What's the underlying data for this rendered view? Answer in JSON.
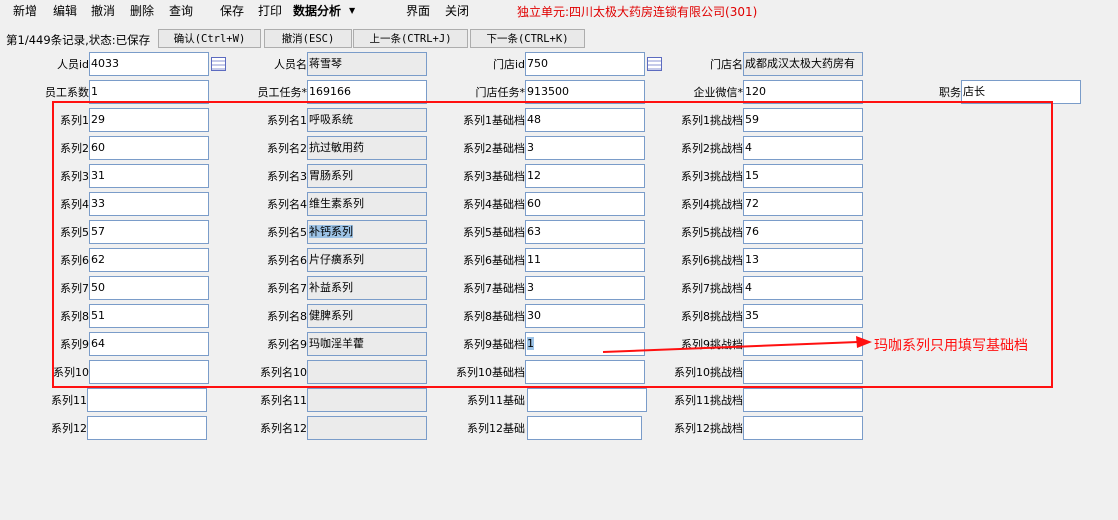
{
  "menu": {
    "items": [
      "新增",
      "编辑",
      "撤消",
      "删除",
      "查询",
      "保存",
      "打印",
      "数据分析",
      "界面",
      "关闭"
    ],
    "unit_title": "独立单元:四川太极大药房连锁有限公司(301)"
  },
  "toolbar": {
    "status": "第1/449条记录,状态:已保存",
    "confirm": "确认(Ctrl+W)",
    "cancel": "撤消(ESC)",
    "prev": "上一条(CTRL+J)",
    "next": "下一条(CTRL+K)"
  },
  "header": {
    "person_id_label": "人员id",
    "person_id": "4033",
    "person_name_label": "人员名",
    "person_name": "蒋雪琴",
    "store_id_label": "门店id",
    "store_id": "750",
    "store_name_label": "门店名",
    "store_name": "成都成汉太极大药房有",
    "emp_coef_label": "员工系数",
    "emp_coef": "1",
    "emp_task_label": "员工任务*",
    "emp_task": "169166",
    "store_task_label": "门店任务*",
    "store_task": "913500",
    "wechat_label": "企业微信*",
    "wechat": "120",
    "position_label": "职务",
    "position": "店长"
  },
  "series": [
    {
      "l1": "系列1",
      "v1": "29",
      "l2": "系列名1",
      "v2": "呼吸系统",
      "l3": "系列1基础档",
      "v3": "48",
      "l4": "系列1挑战档",
      "v4": "59"
    },
    {
      "l1": "系列2",
      "v1": "60",
      "l2": "系列名2",
      "v2": "抗过敏用药",
      "l3": "系列2基础档",
      "v3": "3",
      "l4": "系列2挑战档",
      "v4": "4"
    },
    {
      "l1": "系列3",
      "v1": "31",
      "l2": "系列名3",
      "v2": "胃肠系列",
      "l3": "系列3基础档",
      "v3": "12",
      "l4": "系列3挑战档",
      "v4": "15"
    },
    {
      "l1": "系列4",
      "v1": "33",
      "l2": "系列名4",
      "v2": "维生素系列",
      "l3": "系列4基础档",
      "v3": "60",
      "l4": "系列4挑战档",
      "v4": "72"
    },
    {
      "l1": "系列5",
      "v1": "57",
      "l2": "系列名5",
      "v2": "补钙系列",
      "l3": "系列5基础档",
      "v3": "63",
      "l4": "系列5挑战档",
      "v4": "76"
    },
    {
      "l1": "系列6",
      "v1": "62",
      "l2": "系列名6",
      "v2": "片仔癀系列",
      "l3": "系列6基础档",
      "v3": "11",
      "l4": "系列6挑战档",
      "v4": "13"
    },
    {
      "l1": "系列7",
      "v1": "50",
      "l2": "系列名7",
      "v2": "补益系列",
      "l3": "系列7基础档",
      "v3": "3",
      "l4": "系列7挑战档",
      "v4": "4"
    },
    {
      "l1": "系列8",
      "v1": "51",
      "l2": "系列名8",
      "v2": "健脾系列",
      "l3": "系列8基础档",
      "v3": "30",
      "l4": "系列8挑战档",
      "v4": "35"
    },
    {
      "l1": "系列9",
      "v1": "64",
      "l2": "系列名9",
      "v2": "玛咖淫羊藿",
      "l3": "系列9基础档",
      "v3": "1",
      "l4": "系列9挑战档",
      "v4": ""
    },
    {
      "l1": "系列10",
      "v1": "",
      "l2": "系列名10",
      "v2": "",
      "l3": "系列10基础档",
      "v3": "",
      "l4": "系列10挑战档",
      "v4": ""
    },
    {
      "l1": "系列11",
      "v1": "",
      "l2": "系列名11",
      "v2": "",
      "l3": "系列11基础",
      "v3": "",
      "l4": "系列11挑战档",
      "v4": ""
    },
    {
      "l1": "系列12",
      "v1": "",
      "l2": "系列名12",
      "v2": "",
      "l3": "系列12基础",
      "v3": "",
      "l4": "系列12挑战档",
      "v4": ""
    }
  ],
  "annotation": "玛咖系列只用填写基础档",
  "colors": {
    "annotation_red": "#ff1010",
    "field_border": "#7a9cc9",
    "readonly_bg": "#ebebeb",
    "title_red": "#e00000"
  }
}
